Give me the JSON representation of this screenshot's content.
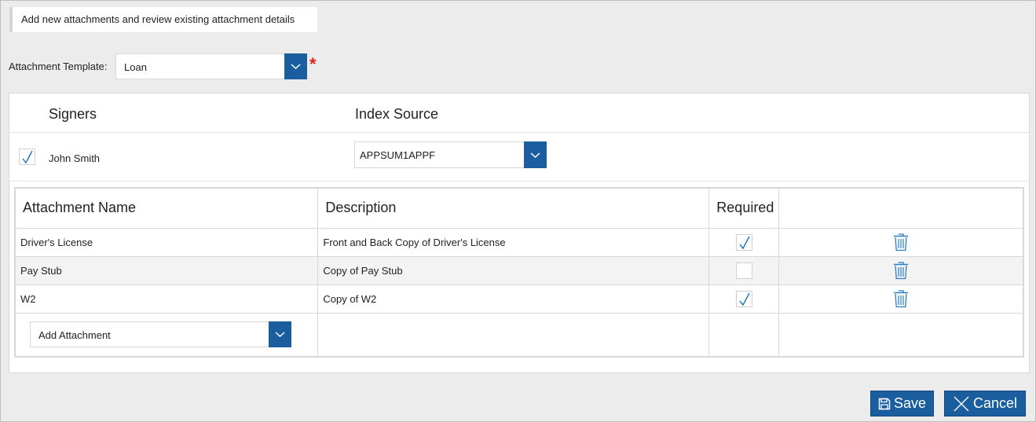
{
  "header": {
    "title": "Add new attachments and review existing attachment details"
  },
  "template": {
    "label": "Attachment Template:",
    "value": "Loan",
    "required_marker": "*"
  },
  "signers_section": {
    "signers_header": "Signers",
    "index_source_header": "Index Source",
    "signers": [
      {
        "name": "John Smith",
        "checked": true,
        "index_source": "APPSUM1APPF"
      }
    ]
  },
  "attachments_table": {
    "columns": [
      "Attachment Name",
      "Description",
      "Required",
      ""
    ],
    "rows": [
      {
        "name": "Driver's License",
        "description": "Front and Back Copy of Driver's License",
        "required": true
      },
      {
        "name": "Pay Stub",
        "description": "Copy of Pay Stub",
        "required": false
      },
      {
        "name": "W2",
        "description": "Copy of W2",
        "required": true
      }
    ],
    "add_attachment_placeholder": "Add Attachment"
  },
  "actions": {
    "save_label": "Save",
    "cancel_label": "Cancel"
  },
  "colors": {
    "accent": "#1a5ea0",
    "required": "#e0201a",
    "check": "#1a6fc0"
  },
  "icons": {
    "dropdown": "chevron-down-icon",
    "delete": "trash-icon",
    "save": "floppy-disk-icon",
    "cancel": "close-icon",
    "check": "checkmark-icon"
  }
}
